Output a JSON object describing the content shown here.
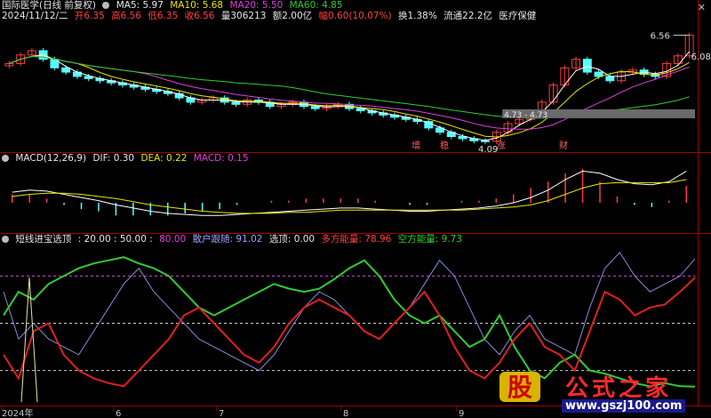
{
  "header": {
    "title": "国际医学(日线 前复权)",
    "ma5_label": "MA5: 5.97",
    "ma10_label": "MA10: 5.68",
    "ma20_label": "MA20: 5.50",
    "ma60_label": "MA60: 4.85",
    "date": "2024/11/12/二",
    "open_label": "开6.35",
    "high_label": "高6.56",
    "low_label": "低6.35",
    "close_label": "收6.56",
    "volume_label": "量306213",
    "amount_label": "额2.00亿",
    "change_label": "幅0.60(10.07%)",
    "turnover_label": "换1.38%",
    "float_label": "流通22.2亿",
    "sector_label": "医疗保健"
  },
  "price_panel": {
    "high_marker": "6.56",
    "right_marker": "6.08",
    "low_marker": "4.09",
    "range_marker": "4.73 - 4.73",
    "signals": [
      "增",
      "稳",
      "涨",
      "财"
    ]
  },
  "macd_panel": {
    "name": "MACD(12,26,9)",
    "dif_label": "DIF: 0.30",
    "dea_label": "DEA: 0.22",
    "macd_label": "MACD: 0.15"
  },
  "indicator_panel": {
    "name": "短线进宝选顶",
    "params": ": 20.00 : 50.00 :",
    "level_80": "80.00",
    "retail_label": "散户跟随: 91.02",
    "top_label": "选顶: 0.00",
    "bull_label": "多方能量: 78.96",
    "bear_label": "空方能量: 9.73"
  },
  "x_axis": {
    "labels": [
      "2024年",
      "6",
      "7",
      "8",
      "9"
    ]
  },
  "watermark": {
    "logo_char": "股",
    "text": "公式之家",
    "url": "www.gszj100.com"
  },
  "colors": {
    "up": "#ff3c3c",
    "down": "#54ffff",
    "ma5": "#ffffff",
    "ma10": "#e6e600",
    "ma20": "#e040e0",
    "ma60": "#33cc33",
    "panel_border": "#a00000"
  },
  "chart_data": {
    "type": "line",
    "candles_close": [
      5.9,
      6.1,
      6.2,
      6.0,
      5.8,
      5.7,
      5.6,
      5.55,
      5.5,
      5.45,
      5.4,
      5.35,
      5.3,
      5.25,
      5.2,
      5.1,
      5.0,
      5.05,
      5.1,
      5.0,
      4.95,
      5.05,
      5.0,
      4.9,
      4.95,
      5.0,
      4.9,
      4.85,
      4.9,
      4.95,
      4.85,
      4.8,
      4.75,
      4.7,
      4.65,
      4.6,
      4.55,
      4.4,
      4.3,
      4.2,
      4.15,
      4.1,
      4.09,
      4.3,
      4.5,
      4.6,
      4.7,
      5.0,
      5.4,
      5.8,
      6.0,
      5.7,
      5.6,
      5.5,
      5.7,
      5.75,
      5.65,
      5.6,
      5.9,
      6.08,
      6.56
    ],
    "ma_series": [
      "MA5",
      "MA10",
      "MA20",
      "MA60"
    ],
    "macd": {
      "dif": [
        0.1,
        0.12,
        0.11,
        0.08,
        0.05,
        0.02,
        -0.02,
        -0.05,
        -0.08,
        -0.1,
        -0.11,
        -0.12,
        -0.12,
        -0.11,
        -0.1,
        -0.09,
        -0.08,
        -0.07,
        -0.06,
        -0.05,
        -0.05,
        -0.06,
        -0.07,
        -0.08,
        -0.08,
        -0.07,
        -0.06,
        -0.05,
        -0.03,
        0.0,
        0.05,
        0.12,
        0.22,
        0.3,
        0.28,
        0.22,
        0.18,
        0.17,
        0.2,
        0.3
      ],
      "dea": [
        0.06,
        0.08,
        0.09,
        0.09,
        0.08,
        0.06,
        0.04,
        0.01,
        -0.02,
        -0.04,
        -0.06,
        -0.08,
        -0.09,
        -0.1,
        -0.1,
        -0.1,
        -0.09,
        -0.09,
        -0.08,
        -0.07,
        -0.07,
        -0.07,
        -0.07,
        -0.07,
        -0.07,
        -0.07,
        -0.07,
        -0.06,
        -0.05,
        -0.04,
        -0.02,
        0.02,
        0.08,
        0.14,
        0.18,
        0.19,
        0.19,
        0.19,
        0.19,
        0.22
      ]
    },
    "indicator": {
      "levels": [
        80,
        50,
        20
      ],
      "retail_follow": [
        70,
        40,
        50,
        40,
        35,
        30,
        45,
        60,
        75,
        85,
        70,
        60,
        50,
        40,
        35,
        30,
        25,
        20,
        30,
        45,
        60,
        70,
        65,
        55,
        45,
        40,
        50,
        60,
        75,
        90,
        80,
        60,
        40,
        30,
        45,
        55,
        40,
        35,
        30,
        60,
        85,
        95,
        80,
        70,
        75,
        80,
        91.02
      ],
      "bull_energy": [
        30,
        15,
        45,
        50,
        30,
        20,
        15,
        12,
        10,
        20,
        30,
        40,
        55,
        60,
        50,
        40,
        30,
        25,
        35,
        50,
        60,
        65,
        60,
        55,
        45,
        40,
        50,
        60,
        70,
        55,
        35,
        20,
        15,
        25,
        40,
        50,
        35,
        30,
        20,
        45,
        70,
        65,
        55,
        60,
        62,
        70,
        78.96
      ],
      "bear_energy": [
        55,
        70,
        65,
        75,
        80,
        85,
        88,
        90,
        92,
        88,
        85,
        80,
        70,
        60,
        55,
        60,
        65,
        70,
        75,
        72,
        70,
        72,
        78,
        85,
        90,
        80,
        65,
        55,
        50,
        55,
        45,
        35,
        40,
        55,
        35,
        20,
        15,
        25,
        30,
        20,
        18,
        15,
        12,
        10,
        12,
        10,
        9.73
      ]
    }
  }
}
